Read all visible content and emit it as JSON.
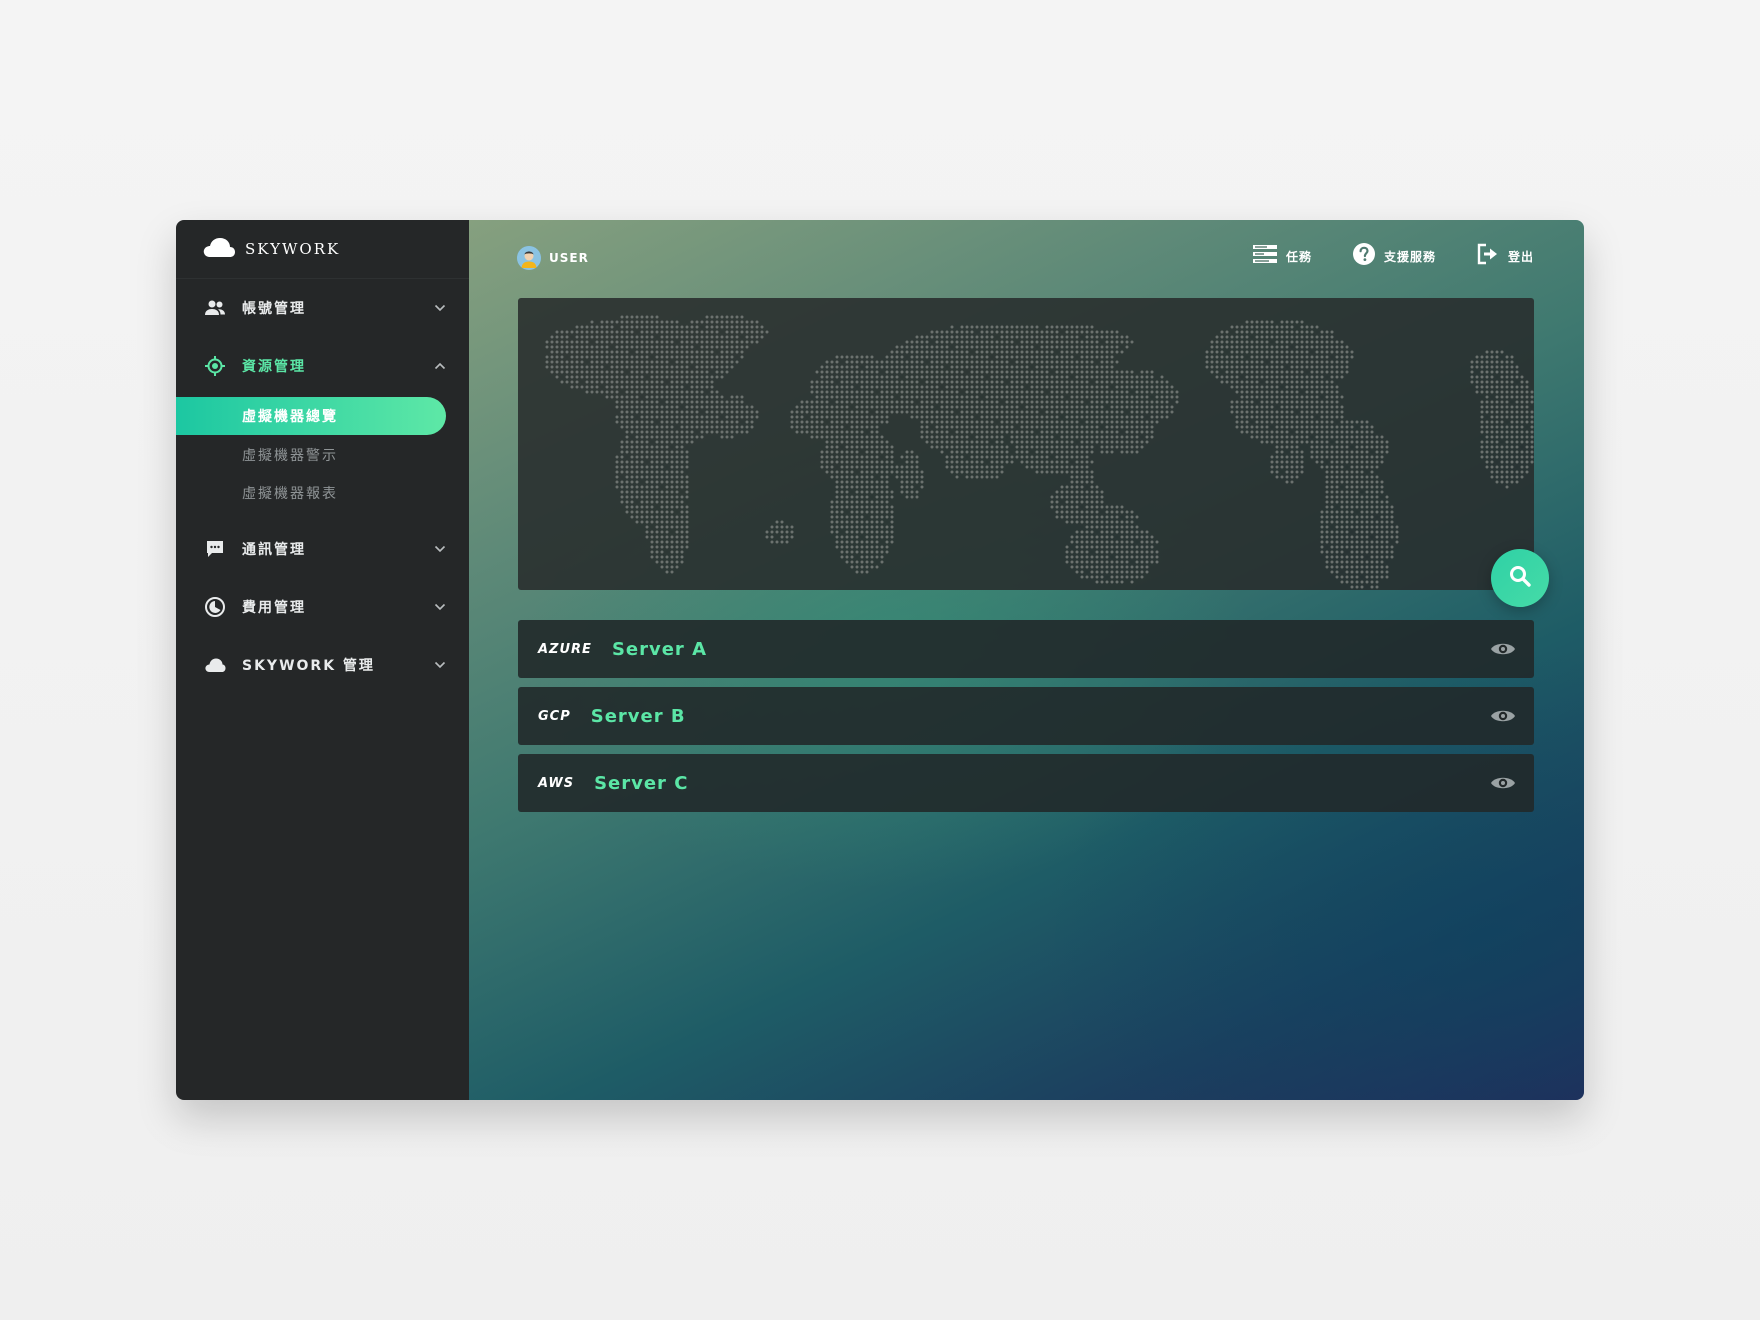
{
  "brand": {
    "name": "SKYWORK"
  },
  "sidebar": {
    "items": [
      {
        "label": "帳號管理",
        "icon": "users-icon",
        "expanded": false
      },
      {
        "label": "資源管理",
        "icon": "target-icon",
        "expanded": true,
        "children": [
          {
            "label": "虛擬機器總覽",
            "selected": true
          },
          {
            "label": "虛擬機器警示",
            "selected": false
          },
          {
            "label": "虛擬機器報表",
            "selected": false
          }
        ]
      },
      {
        "label": "通訊管理",
        "icon": "chat-icon",
        "expanded": false
      },
      {
        "label": "費用管理",
        "icon": "clock-icon",
        "expanded": false
      },
      {
        "label": "SKYWORK 管理",
        "icon": "cloud-icon",
        "expanded": false
      }
    ]
  },
  "header": {
    "user": "USER",
    "actions": [
      {
        "label": "任務",
        "icon": "tasks-icon"
      },
      {
        "label": "支援服務",
        "icon": "help-icon"
      },
      {
        "label": "登出",
        "icon": "logout-icon"
      }
    ]
  },
  "map": {
    "icon": "world-map",
    "action_icon": "search-icon"
  },
  "servers": [
    {
      "provider": "AZURE",
      "name": "Server A"
    },
    {
      "provider": "GCP",
      "name": "Server B"
    },
    {
      "provider": "AWS",
      "name": "Server C"
    }
  ],
  "colors": {
    "sidebar_bg": "#252728",
    "accent": "#5be6a6",
    "accent_gradient_start": "#1cc7a2",
    "accent_gradient_end": "#5ee8a6"
  }
}
